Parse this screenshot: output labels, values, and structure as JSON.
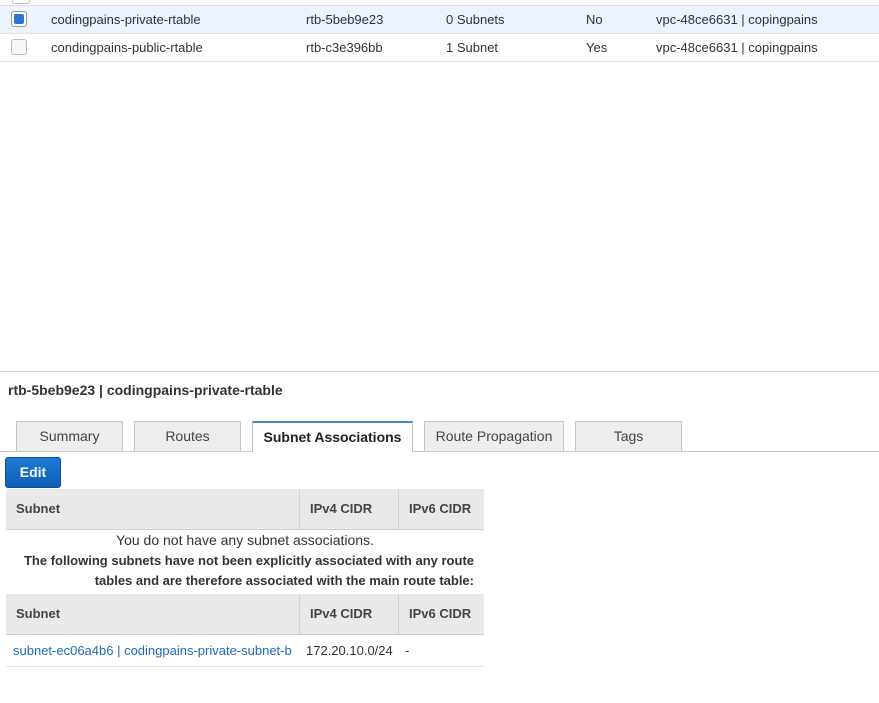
{
  "route_tables": [
    {
      "name": "codingpains-private-rtable",
      "id": "rtb-5beb9e23",
      "subnets": "0 Subnets",
      "main": "No",
      "vpc": "vpc-48ce6631 | copingpains",
      "selected": true
    },
    {
      "name": "condingpains-public-rtable",
      "id": "rtb-c3e396bb",
      "subnets": "1 Subnet",
      "main": "Yes",
      "vpc": "vpc-48ce6631 | copingpains",
      "selected": false
    }
  ],
  "detail": {
    "title": "rtb-5beb9e23 | codingpains-private-rtable",
    "tabs": [
      "Summary",
      "Routes",
      "Subnet Associations",
      "Route Propagation",
      "Tags"
    ],
    "active_tab": "Subnet Associations",
    "edit_label": "Edit",
    "columns": [
      "Subnet",
      "IPv4 CIDR",
      "IPv6 CIDR"
    ],
    "empty_message": "You do not have any subnet associations.",
    "unassociated_note_line1": "The following subnets have not been explicitly associated with any route",
    "unassociated_note_line2": "tables and are therefore associated with the main route table:",
    "unassociated_subnets": [
      {
        "subnet": "subnet-ec06a4b6 | codingpains-private-subnet-b",
        "ipv4": "172.20.10.0/24",
        "ipv6": "-"
      }
    ]
  },
  "colors": {
    "selected_row": "#eaf3fe",
    "checkbox_on": "#2b76d2",
    "edit_button": "#1f79d3",
    "link": "#1f6bb8"
  }
}
